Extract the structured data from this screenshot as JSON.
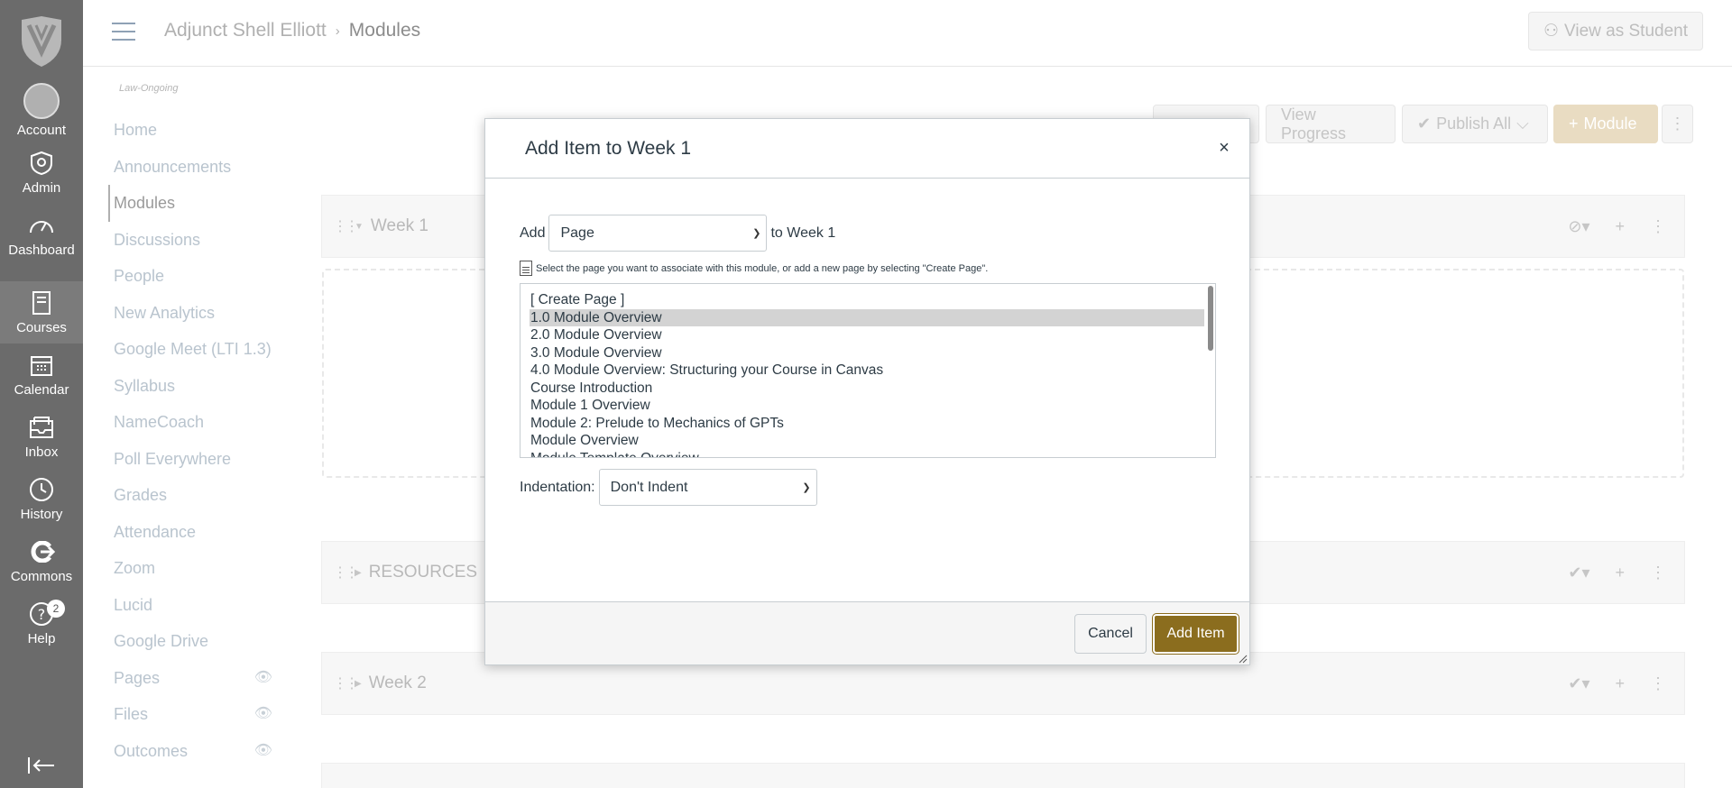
{
  "global_nav": {
    "items": [
      {
        "label": "Account",
        "icon": "avatar-icon"
      },
      {
        "label": "Admin",
        "icon": "shield-icon"
      },
      {
        "label": "Dashboard",
        "icon": "dashboard-icon"
      },
      {
        "label": "Courses",
        "icon": "book-icon",
        "active": true
      },
      {
        "label": "Calendar",
        "icon": "calendar-icon"
      },
      {
        "label": "Inbox",
        "icon": "inbox-icon"
      },
      {
        "label": "History",
        "icon": "clock-icon"
      },
      {
        "label": "Commons",
        "icon": "commons-icon"
      },
      {
        "label": "Help",
        "icon": "help-icon",
        "badge": "2"
      }
    ]
  },
  "header": {
    "breadcrumb": [
      "Adjunct Shell Elliott",
      "Modules"
    ],
    "separator": "›",
    "view_as_student": "View as Student"
  },
  "course_nav": {
    "term": "Law-Ongoing",
    "items": [
      {
        "label": "Home"
      },
      {
        "label": "Announcements"
      },
      {
        "label": "Modules",
        "active": true
      },
      {
        "label": "Discussions"
      },
      {
        "label": "People"
      },
      {
        "label": "New Analytics"
      },
      {
        "label": "Google Meet (LTI 1.3)"
      },
      {
        "label": "Syllabus"
      },
      {
        "label": "NameCoach"
      },
      {
        "label": "Poll Everywhere"
      },
      {
        "label": "Grades"
      },
      {
        "label": "Attendance"
      },
      {
        "label": "Zoom"
      },
      {
        "label": "Lucid"
      },
      {
        "label": "Google Drive"
      },
      {
        "label": "Pages",
        "hidden": true
      },
      {
        "label": "Files",
        "hidden": true
      },
      {
        "label": "Outcomes",
        "hidden": true
      }
    ]
  },
  "toolbar": {
    "view_progress": "View Progress",
    "publish_all": "Publish All",
    "module": "Module"
  },
  "modules": [
    "Week 1",
    "RESOURCES",
    "Week 2"
  ],
  "dialog": {
    "title": "Add Item to Week 1",
    "close": "×",
    "add_label": "Add",
    "add_type": "Page",
    "to_label": "to Week 1",
    "hint": "Select the page you want to associate with this module, or add a new page by selecting \"Create Page\".",
    "options": [
      "[ Create Page ]",
      "1.0 Module Overview",
      "2.0 Module Overview",
      "3.0 Module Overview",
      "4.0 Module Overview: Structuring your Course in Canvas",
      "Course Introduction",
      "Module 1 Overview",
      "Module 2: Prelude to Mechanics of GPTs",
      "Module Overview",
      "Module Template Overview"
    ],
    "selected_index": 1,
    "indent_label": "Indentation:",
    "indent_value": "Don't Indent",
    "cancel": "Cancel",
    "submit": "Add Item"
  }
}
